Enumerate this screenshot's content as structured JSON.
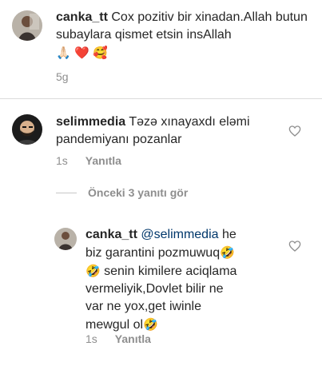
{
  "comments": [
    {
      "username": "canka_tt",
      "text": "Cox pozitiv bir xinadan.Allah butun subaylara qismet etsin insAllah",
      "emojis": [
        "🙏🏻",
        "❤️",
        "🥰"
      ],
      "time": "5g"
    },
    {
      "username": "selimmedia",
      "text": "Təzə xınayaxdı eləmi pandemiyanı pozanlar",
      "time": "1s",
      "reply_label": "Yanıtla"
    }
  ],
  "view_replies": "Önceki 3 yanıtı gör",
  "reply": {
    "username": "canka_tt",
    "mention": "@selimmedia",
    "line1_rest": " he",
    "line2": "biz garantini pozmuwuq",
    "line3": " senin kimilere aciqlama",
    "line4": "vermeliyik,Dovlet bilir ne",
    "line5": "var ne yox,get iwinle",
    "line6": "mewgul ol",
    "emoji": "🤣",
    "time": "1s",
    "reply_label": "Yanıtla"
  },
  "icons": {
    "like": "heart-outline-icon"
  },
  "colors": {
    "text": "#262626",
    "secondary": "#8e8e8e",
    "mention": "#00376b",
    "divider": "#dbdbdb"
  }
}
